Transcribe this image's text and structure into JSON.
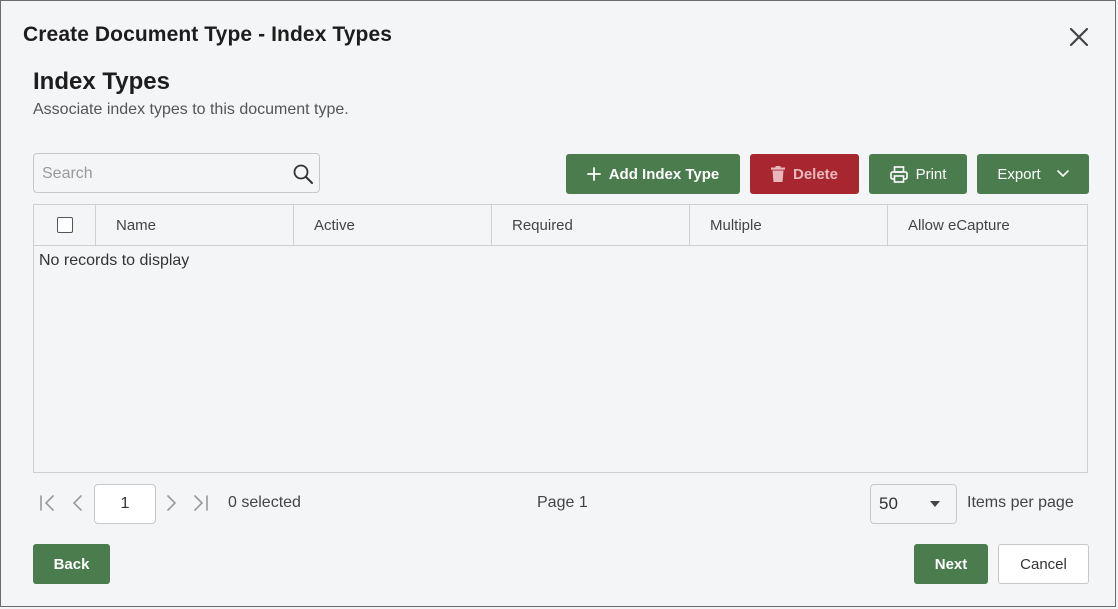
{
  "dialog": {
    "title": "Create Document Type - Index Types"
  },
  "section": {
    "title": "Index Types",
    "description": "Associate index types to this document type."
  },
  "search": {
    "placeholder": "Search",
    "value": ""
  },
  "toolbar": {
    "add_label": "Add Index Type",
    "delete_label": "Delete",
    "print_label": "Print",
    "export_label": "Export"
  },
  "grid": {
    "columns": [
      "Name",
      "Active",
      "Required",
      "Multiple",
      "Allow eCapture"
    ],
    "empty_message": "No records to display"
  },
  "pager": {
    "current_page": "1",
    "selected_text": "0 selected",
    "page_text": "Page 1",
    "per_page": "50",
    "per_page_label": "Items per page"
  },
  "footer": {
    "back_label": "Back",
    "next_label": "Next",
    "cancel_label": "Cancel"
  },
  "colors": {
    "primary_green": "#4a7c4e",
    "danger_red": "#a8262f"
  }
}
